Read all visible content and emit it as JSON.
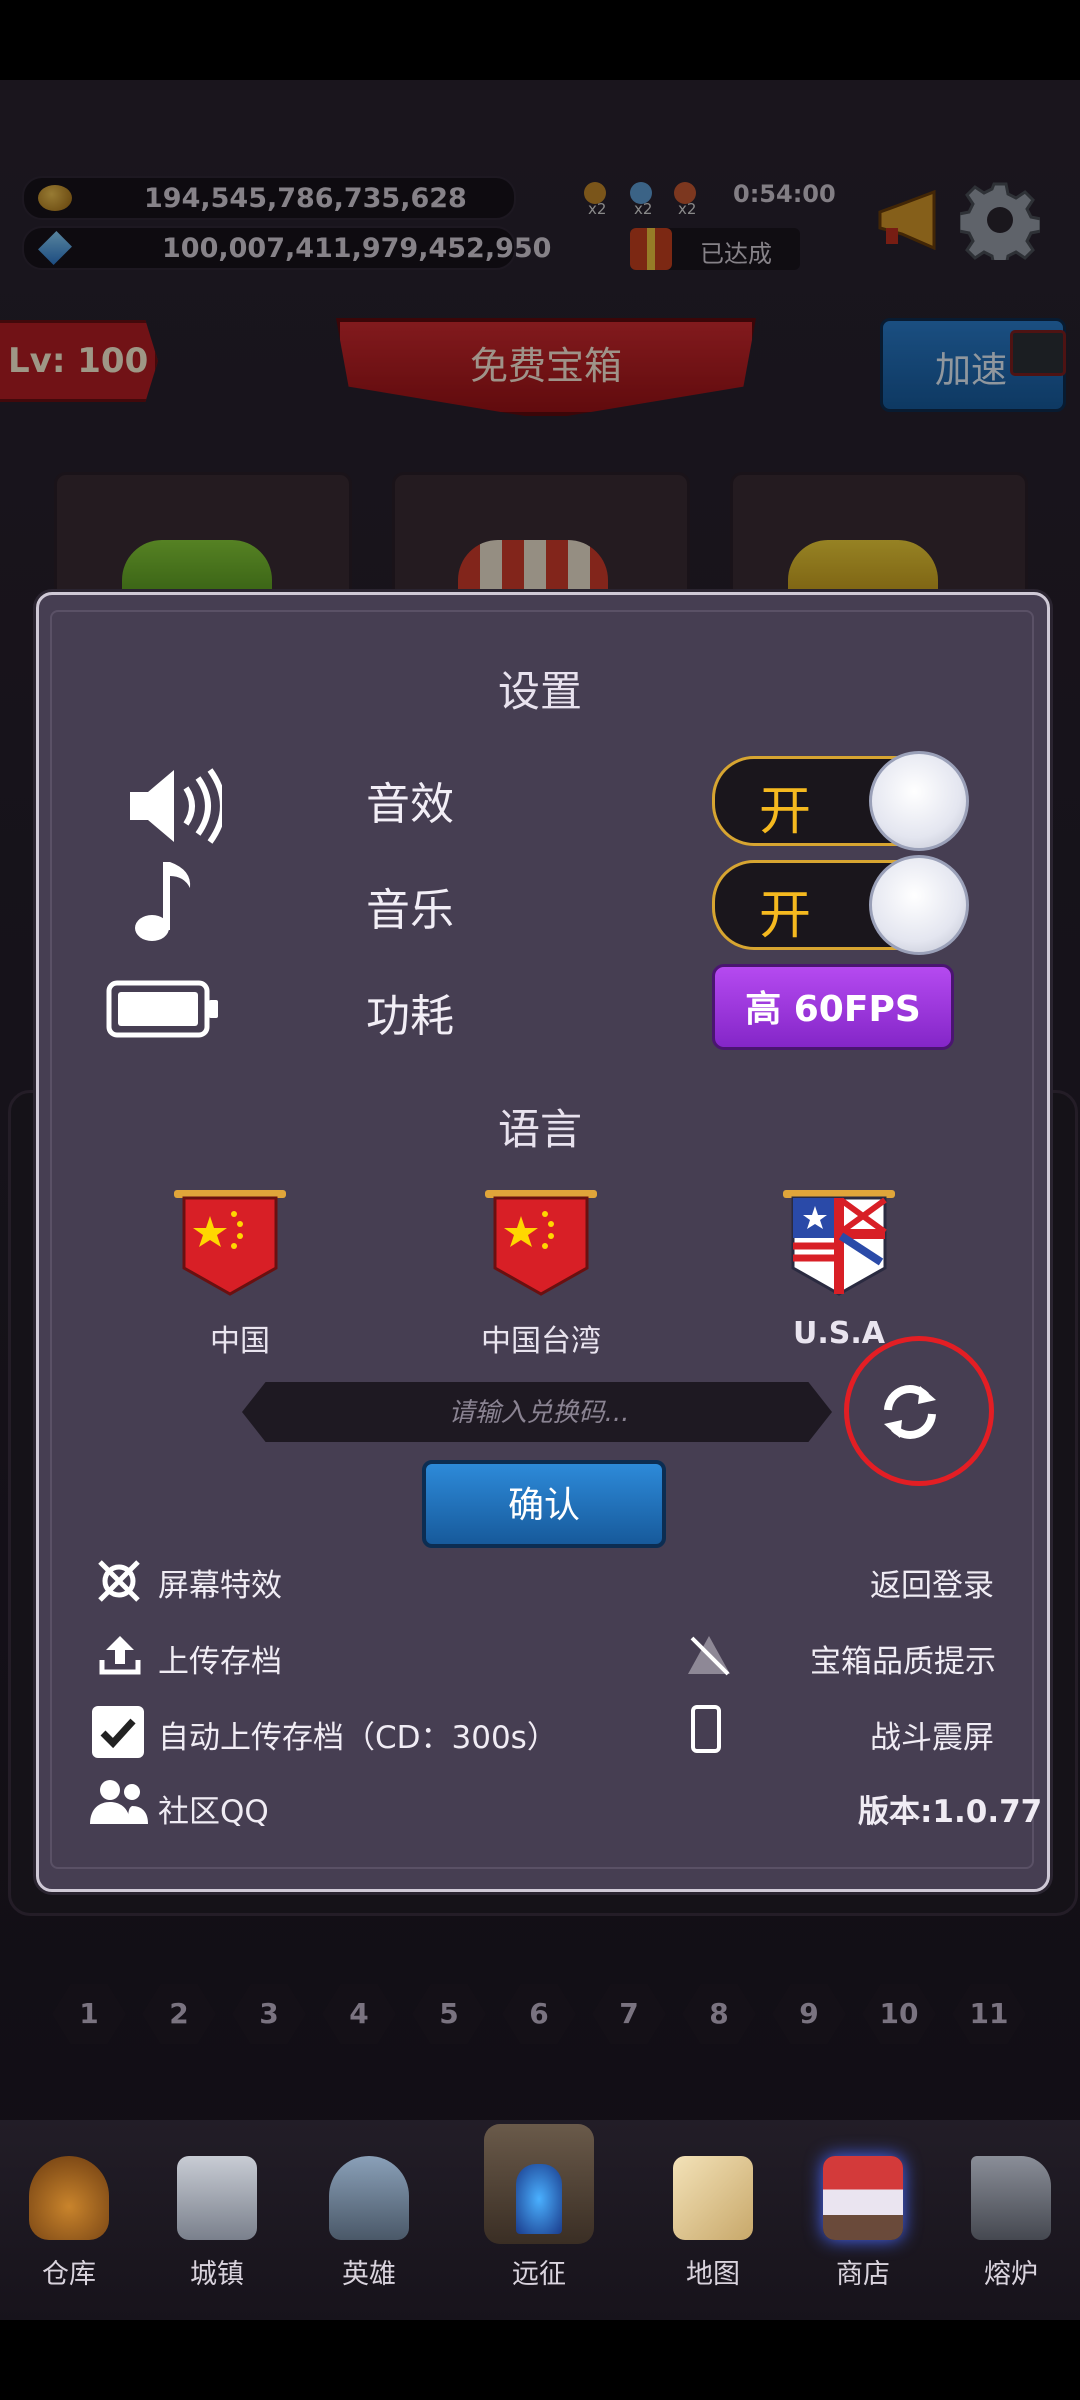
{
  "resources": {
    "gold": "194,545,786,735,628",
    "gems": "100,007,411,979,452,950",
    "multiplier_badges": [
      "x2",
      "x2",
      "x2"
    ],
    "timer": "0:54:00",
    "reward_status": "已达成"
  },
  "top": {
    "level": "Lv: 100",
    "free_chest": "免费宝箱",
    "speed_up": "加速"
  },
  "settings": {
    "title": "设置",
    "sound_label": "音效",
    "sound_state": "开",
    "music_label": "音乐",
    "music_state": "开",
    "power_label": "功耗",
    "power_value": "高 60FPS",
    "language_title": "语言",
    "languages": [
      {
        "label": "中国"
      },
      {
        "label": "中国台湾"
      },
      {
        "label": "U.S.A"
      }
    ],
    "redeem_placeholder": "请输入兑换码...",
    "confirm": "确认",
    "options": {
      "screen_effects": "屏幕特效",
      "back_to_login": "返回登录",
      "upload_save": "上传存档",
      "chest_quality_hint": "宝箱品质提示",
      "auto_upload": "自动上传存档（CD：300s）",
      "battle_shake": "战斗震屏",
      "community": "社区QQ",
      "version": "版本:1.0.77"
    }
  },
  "pager": [
    "1",
    "2",
    "3",
    "4",
    "5",
    "6",
    "7",
    "8",
    "9",
    "10",
    "11"
  ],
  "nav": {
    "items": [
      {
        "label": "仓库"
      },
      {
        "label": "城镇"
      },
      {
        "label": "英雄"
      },
      {
        "label": "远征"
      },
      {
        "label": "地图"
      },
      {
        "label": "商店"
      },
      {
        "label": "熔炉"
      }
    ]
  }
}
